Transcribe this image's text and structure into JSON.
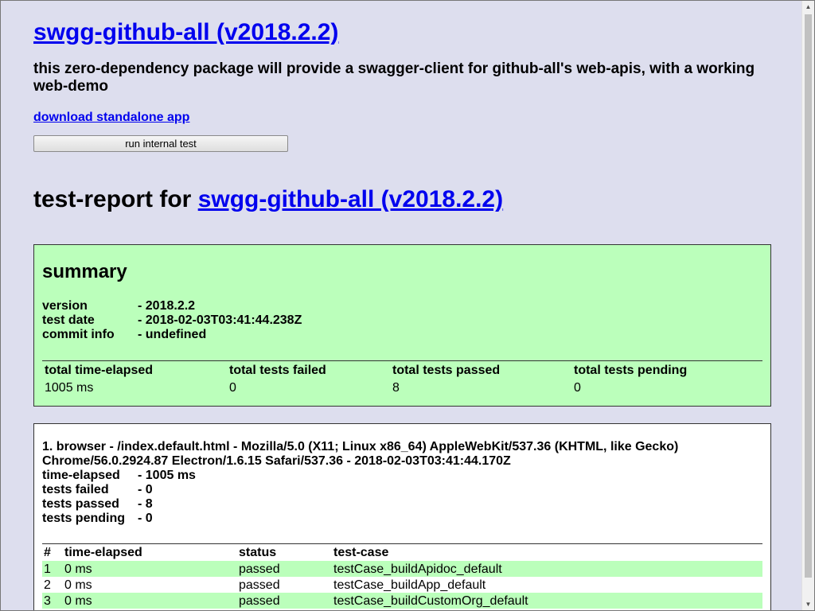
{
  "header": {
    "title_link": "swgg-github-all (v2018.2.2)",
    "description": "this zero-dependency package will provide a swagger-client for github-all's web-apis, with a working web-demo",
    "download_link": "download standalone app",
    "run_button": "run internal test"
  },
  "report": {
    "title_prefix": "test-report for ",
    "title_link": "swgg-github-all (v2018.2.2)"
  },
  "summary": {
    "heading": "summary",
    "version_key": "version",
    "version_val": "- 2018.2.2",
    "date_key": "test date",
    "date_val": "- 2018-02-03T03:41:44.238Z",
    "commit_key": "commit info",
    "commit_val": "- undefined",
    "totals_headers": [
      "total time-elapsed",
      "total tests failed",
      "total tests passed",
      "total tests pending"
    ],
    "totals_values": [
      "1005 ms",
      "0",
      "8",
      "0"
    ]
  },
  "browser": {
    "line1": "1. browser - /index.default.html - Mozilla/5.0 (X11; Linux x86_64) AppleWebKit/537.36 (KHTML, like Gecko)",
    "line2": "Chrome/56.0.2924.87 Electron/1.6.15 Safari/537.36 - 2018-02-03T03:41:44.170Z",
    "elapsed_key": "time-elapsed",
    "elapsed_val": "- 1005 ms",
    "failed_key": "tests failed",
    "failed_val": "- 0",
    "passed_key": "tests passed",
    "passed_val": "- 8",
    "pending_key": "tests pending",
    "pending_val": "- 0",
    "table_headers": [
      "#",
      "time-elapsed",
      "status",
      "test-case"
    ],
    "rows": [
      {
        "num": "1",
        "elapsed": "0 ms",
        "status": "passed",
        "name": "testCase_buildApidoc_default"
      },
      {
        "num": "2",
        "elapsed": "0 ms",
        "status": "passed",
        "name": "testCase_buildApp_default"
      },
      {
        "num": "3",
        "elapsed": "0 ms",
        "status": "passed",
        "name": "testCase_buildCustomOrg_default"
      }
    ]
  },
  "colors": {
    "background": "#dddeee",
    "passed_green": "#bbffbb",
    "link_blue": "#0000ee"
  },
  "icons": {
    "scroll_up": "scroll-up-arrow-icon",
    "scroll_down": "scroll-down-arrow-icon"
  }
}
